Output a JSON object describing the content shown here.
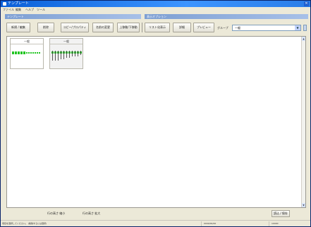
{
  "window": {
    "title": "テンプレート"
  },
  "menu": {
    "items": [
      "ファイル",
      "編集",
      "ヘルプ",
      "ツール"
    ]
  },
  "groups": {
    "left": "テンプレート",
    "right": "表示オプション"
  },
  "toolbar": {
    "buttons": [
      "新規 / 編集",
      "削除",
      "コピー/プロパティ",
      "名前の変更",
      "上移動/下移動",
      "リスト化表示"
    ],
    "right_buttons": [
      "詳細",
      "プレビュー"
    ],
    "dropdown_label": "グループ",
    "dropdown_value": "一般"
  },
  "cards": [
    {
      "title": "一般",
      "accent": "#22c522"
    },
    {
      "title": "一般",
      "accent": "#22c522"
    }
  ],
  "bottom": {
    "label_left": "行の高さ 縮小",
    "label_right": "行の高さ 拡大",
    "button": "読込 / 保存"
  },
  "status": {
    "left": "項目を選択してください。 (削除するには選択)",
    "mid": "0000/00/00",
    "right": "10000"
  }
}
